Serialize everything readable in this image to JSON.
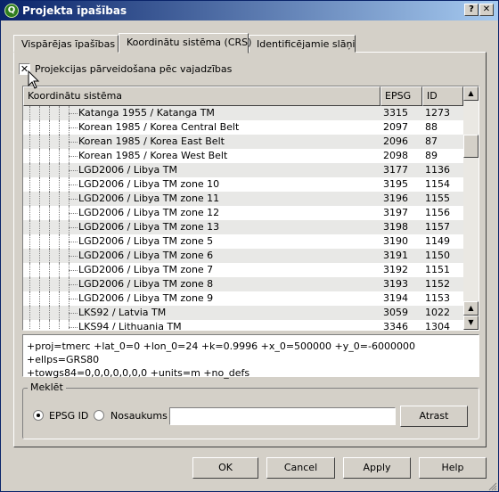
{
  "window": {
    "title": "Projekta īpašības",
    "app_icon": "qgis-icon",
    "help_button": "?",
    "close_button": "✕"
  },
  "tabs": [
    {
      "label": "Vispārējas īpašības",
      "active": false
    },
    {
      "label": "Koordinātu sistēma (CRS)",
      "active": true
    },
    {
      "label": "Identificējamie slāņi",
      "active": false
    }
  ],
  "reprojection": {
    "label": "Projekcijas pārveidošana pēc vajadzības",
    "checked": true
  },
  "crs_table": {
    "columns": [
      "Koordinātu sistēma",
      "EPSG",
      "ID"
    ],
    "rows": [
      {
        "name": "Katanga 1955 / Katanga TM",
        "epsg": "3315",
        "id": "1273"
      },
      {
        "name": "Korean 1985 / Korea Central Belt",
        "epsg": "2097",
        "id": "88"
      },
      {
        "name": "Korean 1985 / Korea East Belt",
        "epsg": "2096",
        "id": "87"
      },
      {
        "name": "Korean 1985 / Korea West Belt",
        "epsg": "2098",
        "id": "89"
      },
      {
        "name": "LGD2006 / Libya TM",
        "epsg": "3177",
        "id": "1136"
      },
      {
        "name": "LGD2006 / Libya TM zone 10",
        "epsg": "3195",
        "id": "1154"
      },
      {
        "name": "LGD2006 / Libya TM zone 11",
        "epsg": "3196",
        "id": "1155"
      },
      {
        "name": "LGD2006 / Libya TM zone 12",
        "epsg": "3197",
        "id": "1156"
      },
      {
        "name": "LGD2006 / Libya TM zone 13",
        "epsg": "3198",
        "id": "1157"
      },
      {
        "name": "LGD2006 / Libya TM zone 5",
        "epsg": "3190",
        "id": "1149"
      },
      {
        "name": "LGD2006 / Libya TM zone 6",
        "epsg": "3191",
        "id": "1150"
      },
      {
        "name": "LGD2006 / Libya TM zone 7",
        "epsg": "3192",
        "id": "1151"
      },
      {
        "name": "LGD2006 / Libya TM zone 8",
        "epsg": "3193",
        "id": "1152"
      },
      {
        "name": "LGD2006 / Libya TM zone 9",
        "epsg": "3194",
        "id": "1153"
      },
      {
        "name": "LKS92 / Latvia TM",
        "epsg": "3059",
        "id": "1022"
      },
      {
        "name": "LKS94 / Lithuania TM",
        "epsg": "3346",
        "id": "1304"
      }
    ]
  },
  "proj_string": {
    "line1": "+proj=tmerc +lat_0=0 +lon_0=24 +k=0.9996 +x_0=500000 +y_0=-6000000 +ellps=GRS80",
    "line2": "+towgs84=0,0,0,0,0,0,0 +units=m +no_defs"
  },
  "search": {
    "title": "Meklēt",
    "option_epsg": "EPSG ID",
    "option_name": "Nosaukums",
    "selected": "EPSG ID",
    "value": "",
    "find_button": "Atrast"
  },
  "buttons": {
    "ok": "OK",
    "cancel": "Cancel",
    "apply": "Apply",
    "help": "Help"
  },
  "colors": {
    "title_gradient_start": "#0a246a",
    "title_gradient_end": "#a6caf0",
    "face": "#d4d0c8",
    "row_alt": "#e8e8e6"
  }
}
